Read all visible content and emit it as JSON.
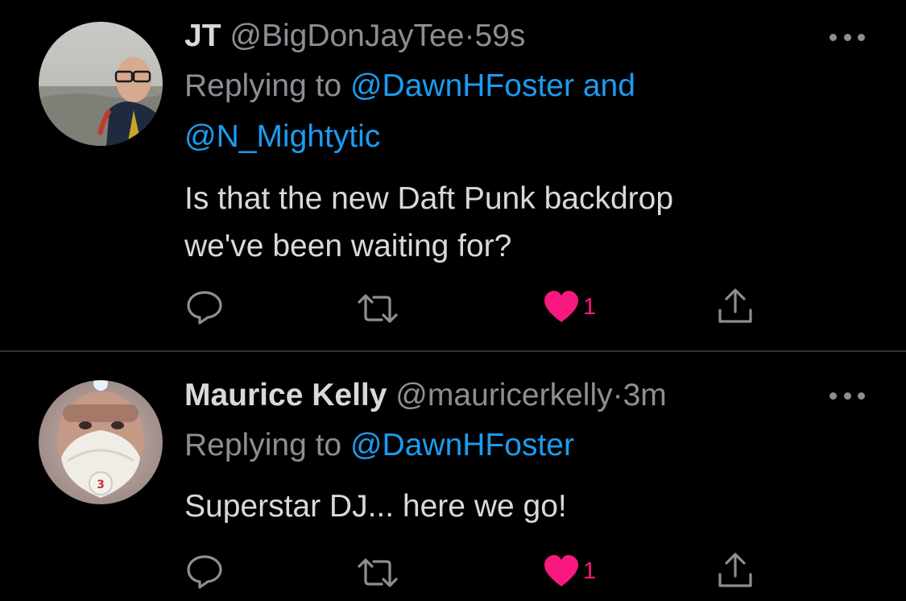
{
  "colors": {
    "background": "#000000",
    "text": "#D9D9D9",
    "secondary_text": "#8B8F94",
    "link": "#1D9BF0",
    "like": "#F91880",
    "divider": "#2F3336"
  },
  "tweets": [
    {
      "name": "JT",
      "handle": "@BigDonJayTee",
      "separator": "·",
      "time": "59s",
      "replying_prefix": "Replying to",
      "mention_1": "@DawnHFoster",
      "conjunction": "and",
      "mention_2": "@N_Mightytic",
      "text_line_1": "Is that the new Daft Punk backdrop",
      "text_line_2": "we've been waiting for?",
      "like_count": "1",
      "liked": true,
      "icons": [
        "reply-icon",
        "retweet-icon",
        "like-icon",
        "share-icon",
        "more-icon"
      ]
    },
    {
      "name": "Maurice Kelly",
      "handle": "@mauricerkelly",
      "separator": "·",
      "time": "3m",
      "replying_prefix": "Replying to",
      "mention_1": "@DawnHFoster",
      "text_line_1": "Superstar DJ... here we go!",
      "like_count": "1",
      "liked": true,
      "icons": [
        "reply-icon",
        "retweet-icon",
        "like-icon",
        "share-icon",
        "more-icon"
      ]
    }
  ]
}
